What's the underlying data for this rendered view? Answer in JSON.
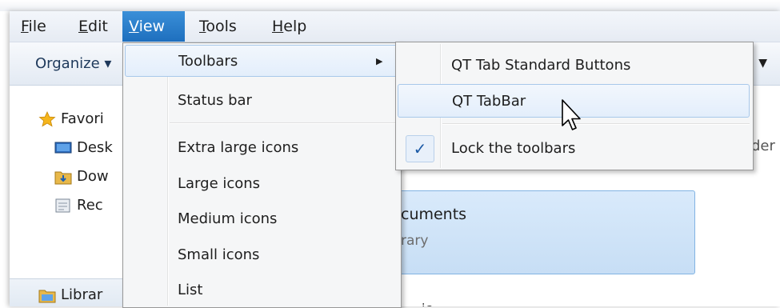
{
  "menubar": {
    "items": [
      {
        "prefix": "",
        "ul": "F",
        "rest": "ile"
      },
      {
        "prefix": "",
        "ul": "E",
        "rest": "dit"
      },
      {
        "prefix": "",
        "ul": "V",
        "rest": "iew"
      },
      {
        "prefix": "",
        "ul": "T",
        "rest": "ools"
      },
      {
        "prefix": "",
        "ul": "H",
        "rest": "elp"
      }
    ]
  },
  "toolbar": {
    "organize": "Organize",
    "organize_arrow": "▾",
    "right_arrow": "▼"
  },
  "nav": {
    "items": [
      {
        "label": "Favori",
        "icon": "star-icon"
      },
      {
        "label": "Desk",
        "icon": "desktop-icon"
      },
      {
        "label": "Dow",
        "icon": "downloads-icon"
      },
      {
        "label": "Rec",
        "icon": "recent-places-icon"
      }
    ],
    "libraries": "Librar"
  },
  "content": {
    "tile_title": "cuments",
    "tile_sub": "rary",
    "right_stub": "lder",
    "bottom_stub": "ic"
  },
  "view_menu": {
    "items": [
      {
        "label": "Toolbars",
        "has_submenu": true
      },
      {
        "label": "Status bar"
      },
      {
        "label": "Extra large icons"
      },
      {
        "label": "Large icons"
      },
      {
        "label": "Medium icons"
      },
      {
        "label": "Small icons"
      },
      {
        "label": "List"
      }
    ],
    "submenu_arrow": "▶"
  },
  "toolbars_submenu": {
    "items": [
      {
        "label": "QT Tab Standard Buttons",
        "checked": false
      },
      {
        "label": "QT TabBar",
        "checked": false,
        "hover": true
      },
      {
        "label": "Lock the toolbars",
        "checked": true
      }
    ],
    "check_glyph": "✓"
  },
  "colors": {
    "accent": "#1e6fbe",
    "selection_border": "#a8c8ea"
  }
}
